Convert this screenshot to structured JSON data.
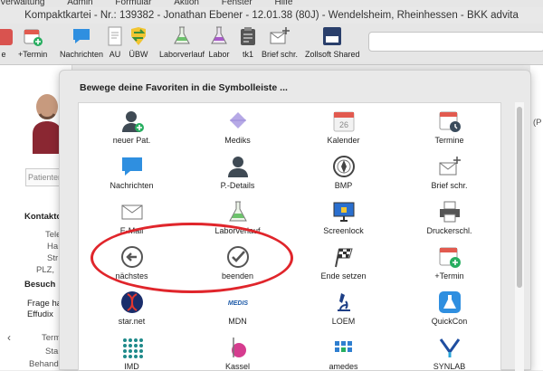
{
  "menubar": {
    "items": [
      "Verwaltung",
      "Admin",
      "Formular",
      "Aktion",
      "Fenster",
      "Hilfe"
    ]
  },
  "window": {
    "title": "Kompaktkartei - Nr.: 139382 - Jonathan Ebener - 12.01.38 (80J) - Wendelsheim, Rheinhessen - BKK advita"
  },
  "toolbar": {
    "items": [
      {
        "label": "e",
        "icon": "app-icon"
      },
      {
        "label": "+Termin",
        "icon": "calendar-plus-icon"
      },
      {
        "label": "Nachrichten",
        "icon": "chat-bubble-icon"
      },
      {
        "label": "AU",
        "icon": "document-icon"
      },
      {
        "label": "ÜBW",
        "icon": "transfer-icon"
      },
      {
        "label": "Laborverlauf",
        "icon": "flask-icon"
      },
      {
        "label": "Labor",
        "icon": "flask-icon"
      },
      {
        "label": "tk1",
        "icon": "clipboard-icon"
      },
      {
        "label": "Brief schr.",
        "icon": "envelope-plus-icon"
      },
      {
        "label": "Zollsoft Shared",
        "icon": "shared-icon"
      }
    ],
    "shared_badge": "zollsoft_shared"
  },
  "background": {
    "patient_placeholder": "Patienten",
    "contact_heading": "Kontakto",
    "contact_rows": [
      "Tele",
      "Ha",
      "Str",
      "PLZ,"
    ],
    "visit_heading": "Besuch",
    "visit_text_1": "Frage ha",
    "visit_text_2": "Effudix",
    "lower_rows": [
      "Term",
      "Sta",
      "Behand"
    ],
    "right_edge_text": "(P"
  },
  "panel": {
    "title": "Bewege deine Favoriten in die Symbolleiste ...",
    "items": [
      {
        "label": "neuer Pat.",
        "icon": "person-plus-icon"
      },
      {
        "label": "Mediks",
        "icon": "pill-icon"
      },
      {
        "label": "Kalender",
        "icon": "calendar-icon",
        "badge": "26"
      },
      {
        "label": "Termine",
        "icon": "calendar-clock-icon"
      },
      {
        "label": "Nachrichten",
        "icon": "chat-bubble-icon"
      },
      {
        "label": "P.-Details",
        "icon": "person-icon"
      },
      {
        "label": "BMP",
        "icon": "compass-icon"
      },
      {
        "label": "Brief schr.",
        "icon": "envelope-plus-icon"
      },
      {
        "label": "E-Mail",
        "icon": "envelope-icon"
      },
      {
        "label": "Laborverlauf",
        "icon": "flask-icon"
      },
      {
        "label": "Screenlock",
        "icon": "monitor-icon"
      },
      {
        "label": "Druckerschl.",
        "icon": "printer-icon"
      },
      {
        "label": "nächstes",
        "icon": "arrow-left-circle-icon"
      },
      {
        "label": "beenden",
        "icon": "check-circle-icon"
      },
      {
        "label": "Ende setzen",
        "icon": "checkered-flag-icon"
      },
      {
        "label": "+Termin",
        "icon": "calendar-plus-icon"
      },
      {
        "label": "star.net",
        "icon": "dna-icon"
      },
      {
        "label": "MDN",
        "icon": "mdn-logo-icon",
        "logo_text": "MEDIS"
      },
      {
        "label": "LOEM",
        "icon": "microscope-icon"
      },
      {
        "label": "QuickCon",
        "icon": "app-flask-icon"
      },
      {
        "label": "IMD",
        "icon": "dots-grid-icon"
      },
      {
        "label": "Kassel",
        "icon": "kassel-logo-icon"
      },
      {
        "label": "amedes",
        "icon": "amedes-logo-icon"
      },
      {
        "label": "SYNLAB",
        "icon": "synlab-logo-icon"
      }
    ]
  },
  "colors": {
    "highlight": "#e0252b",
    "accent_blue": "#2f8fe0",
    "accent_red": "#d9534f",
    "accent_green": "#27ae60"
  }
}
